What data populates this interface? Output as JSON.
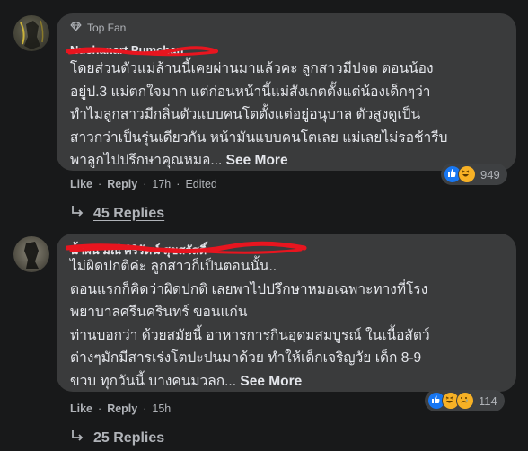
{
  "comments": [
    {
      "badge": "Top Fan",
      "author": "Nuchanart Pumchan",
      "text": "โดยส่วนตัวแม่ล้านนี้เคยผ่านมาแล้วคะ ลูกสาวมีปจด ตอนน้อง\nอยู่ป.3 แม่ตกใจมาก แต่ก่อนหน้านี้แม่สังเกตตั้งแต่น้องเด็กๆว่า\nทำไมลูกสาวมีกลิ่นตัวแบบคนโตตั้งแต่อยู่อนุบาล ตัวสูงดูเป็น\nสาวกว่าเป็นรุ่นเดียวกัน หน้ามันแบบคนโตเลย แม่เลยไม่รอช้ารีบ\nพาลูกไปปรึกษาคุณหมอ...",
      "see_more": "See More",
      "reaction_count": "949",
      "reaction_icons": [
        "like-icon",
        "haha-icon"
      ],
      "like": "Like",
      "reply": "Reply",
      "time": "17h",
      "edited": "Edited",
      "replies": "45 Replies"
    },
    {
      "author": "น้ำฝน มณี ศิริรัตน์ สุขสวัสดิ์",
      "text": "ไม่ผิดปกติค่ะ ลูกสาวก็เป็นตอนนั้น..\nตอนแรกก็คิดว่าผิดปกติ เลยพาไปปรึกษาหมอเฉพาะทางที่โรง\nพยาบาลศรีนครินทร์ ขอนแก่น\nท่านบอกว่า ด้วยสมัยนี้ อาหารการกินอุดมสมบูรณ์ ในเนื้อสัตว์\nต่างๆมักมีสารเร่งโตปะปนมาด้วย ทำให้เด็กเจริญวัย เด็ก 8-9\nขวบ ทุกวันนี้ บางคนมวลก...",
      "see_more": "See More",
      "reaction_count": "114",
      "reaction_icons": [
        "like-icon",
        "haha-icon",
        "sad-icon"
      ],
      "like": "Like",
      "reply": "Reply",
      "time": "15h",
      "replies": "25 Replies"
    }
  ],
  "colors": {
    "background": "#18191a",
    "bubble": "#3a3b3c",
    "secondary_text": "#b0b3b8",
    "scribble": "#e8151f",
    "like_blue": "#1877f2"
  }
}
